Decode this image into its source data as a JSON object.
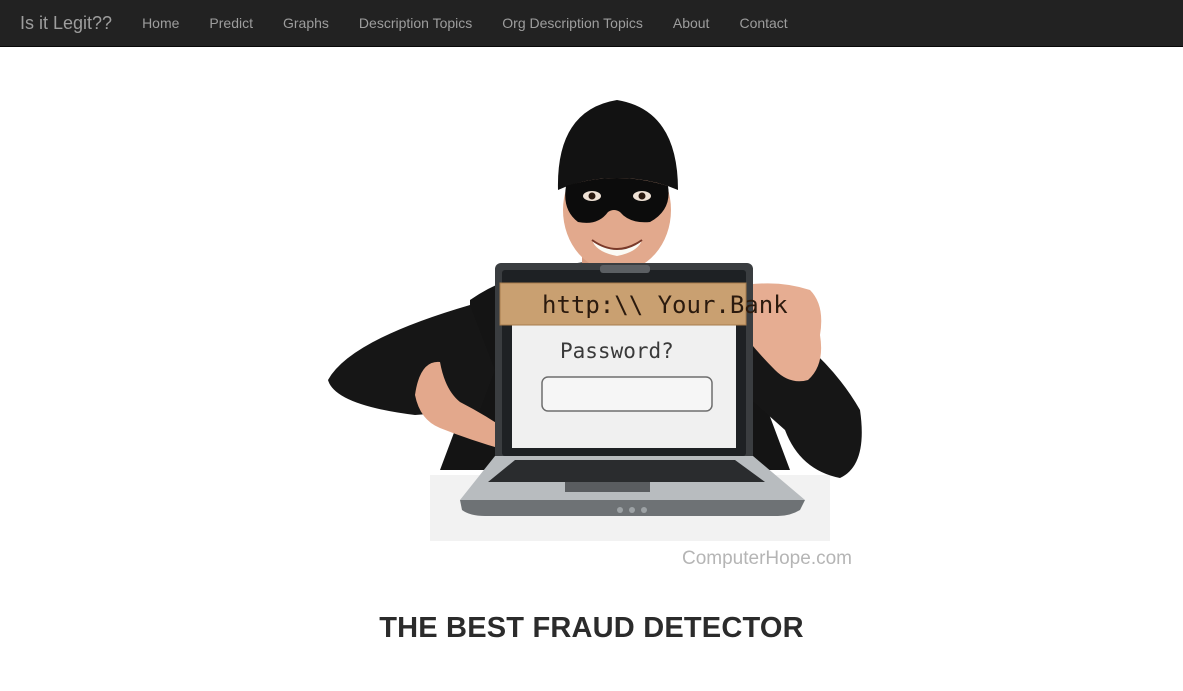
{
  "navbar": {
    "brand": "Is it Legit??",
    "links": [
      "Home",
      "Predict",
      "Graphs",
      "Description Topics",
      "Org Description Topics",
      "About",
      "Contact"
    ]
  },
  "hero": {
    "url_sign": "http:\\\\ Your.Bank",
    "password_prompt": "Password?",
    "watermark": "ComputerHope.com"
  },
  "main": {
    "headline": "THE BEST FRAUD DETECTOR"
  },
  "colors": {
    "navbar_bg": "#222222",
    "navbar_text": "#9d9d9d",
    "headline_text": "#2b2b2b"
  }
}
